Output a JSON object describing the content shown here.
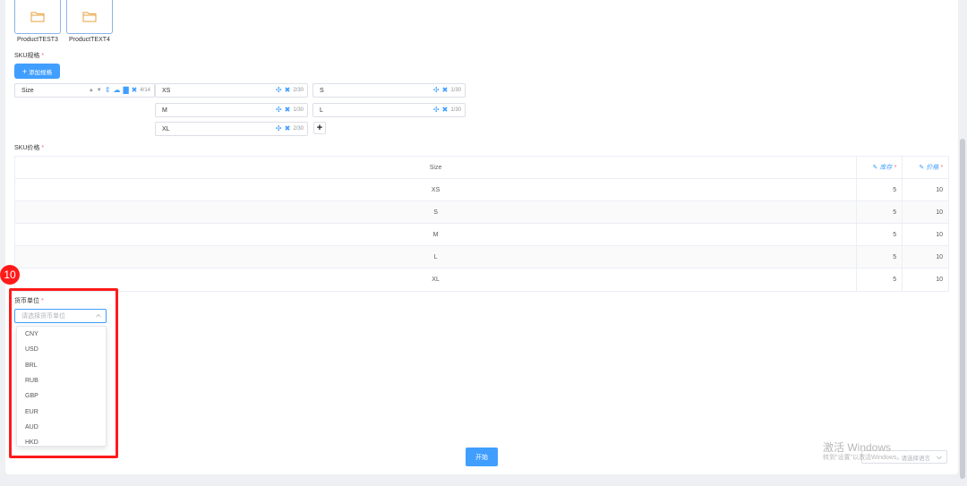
{
  "products": [
    {
      "name": "ProductTEST3"
    },
    {
      "name": "ProductTEXT4"
    }
  ],
  "sku_spec": {
    "label": "SKU规格",
    "add_button": "添加规格",
    "spec_name": {
      "value": "Size",
      "count": "4/14"
    },
    "values": [
      {
        "value": "XS",
        "count": "2/30"
      },
      {
        "value": "S",
        "count": "1/30"
      },
      {
        "value": "M",
        "count": "1/30"
      },
      {
        "value": "L",
        "count": "1/30"
      },
      {
        "value": "XL",
        "count": "2/30"
      }
    ],
    "add_value_button": "+"
  },
  "sku_price": {
    "label": "SKU价格",
    "headers": {
      "size": "Size",
      "stock": "库存",
      "price": "价格"
    },
    "rows": [
      {
        "size": "XS",
        "stock": "5",
        "price": "10"
      },
      {
        "size": "S",
        "stock": "5",
        "price": "10"
      },
      {
        "size": "M",
        "stock": "5",
        "price": "10"
      },
      {
        "size": "L",
        "stock": "5",
        "price": "10"
      },
      {
        "size": "XL",
        "stock": "5",
        "price": "10"
      }
    ]
  },
  "step_badge": "10",
  "currency": {
    "label": "货币单位",
    "placeholder": "请选择货币单位",
    "options": [
      "CNY",
      "USD",
      "BRL",
      "RUB",
      "GBP",
      "EUR",
      "AUD",
      "HKD"
    ]
  },
  "start_button": "开始",
  "watermark": {
    "title": "激活 Windows",
    "subtitle": "转到\"设置\"以激活Windows。"
  },
  "bottom_select": {
    "placeholder": "请选择语言"
  },
  "colors": {
    "accent": "#409eff",
    "highlight": "#ff1a1a",
    "required": "#f56c6c"
  }
}
